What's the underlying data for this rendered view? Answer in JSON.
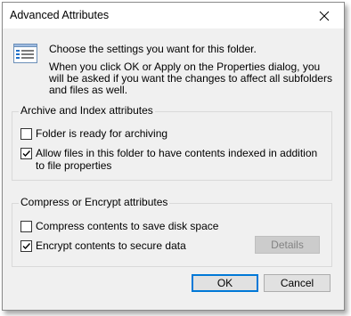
{
  "window": {
    "title": "Advanced Attributes"
  },
  "info": {
    "line1": "Choose the settings you want for this folder.",
    "line2": "When you click OK or Apply on the Properties dialog, you will be asked if you want the changes to affect all subfolders and files as well."
  },
  "archive_group": {
    "label": "Archive and Index attributes",
    "folder_ready": {
      "label": "Folder is ready for archiving",
      "checked": false
    },
    "allow_index": {
      "label": "Allow files in this folder to have contents indexed in addition to file properties",
      "checked": true
    }
  },
  "compress_group": {
    "label": "Compress or Encrypt attributes",
    "compress": {
      "label": "Compress contents to save disk space",
      "checked": false
    },
    "encrypt": {
      "label": "Encrypt contents to secure data",
      "checked": true
    },
    "details_label": "Details"
  },
  "buttons": {
    "ok": "OK",
    "cancel": "Cancel"
  },
  "icons": {
    "close": "close-icon",
    "info": "attributes-list-icon",
    "check": "checkmark-icon"
  }
}
